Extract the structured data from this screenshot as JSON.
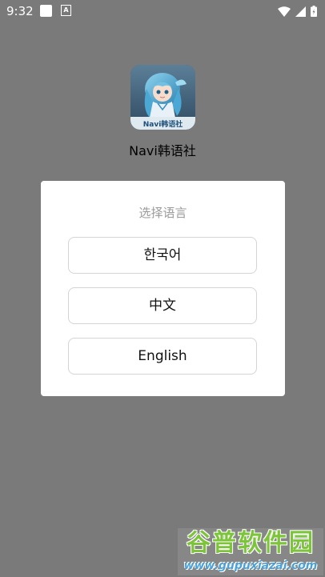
{
  "status_bar": {
    "time": "9:32",
    "notification_icon_a": "A",
    "icons": [
      "square-notification-icon",
      "a-notification-icon",
      "wifi-icon",
      "signal-icon",
      "battery-icon"
    ]
  },
  "app": {
    "name": "Navi韩语社",
    "icon_caption": "Navi韩语社"
  },
  "dialog": {
    "title": "选择语言",
    "options": [
      {
        "label": "한국어"
      },
      {
        "label": "中文"
      },
      {
        "label": "English"
      }
    ]
  },
  "watermark": {
    "brand": "谷普软件园",
    "url": "www.gupuxiazai.com"
  },
  "colors": {
    "scrim": "#7a7a7a",
    "dialog_bg": "#ffffff",
    "title_gray": "#9a9a9a",
    "option_border": "#d4d4d4",
    "watermark_green": "#7cc43a",
    "watermark_blue": "#4aa1d8"
  }
}
